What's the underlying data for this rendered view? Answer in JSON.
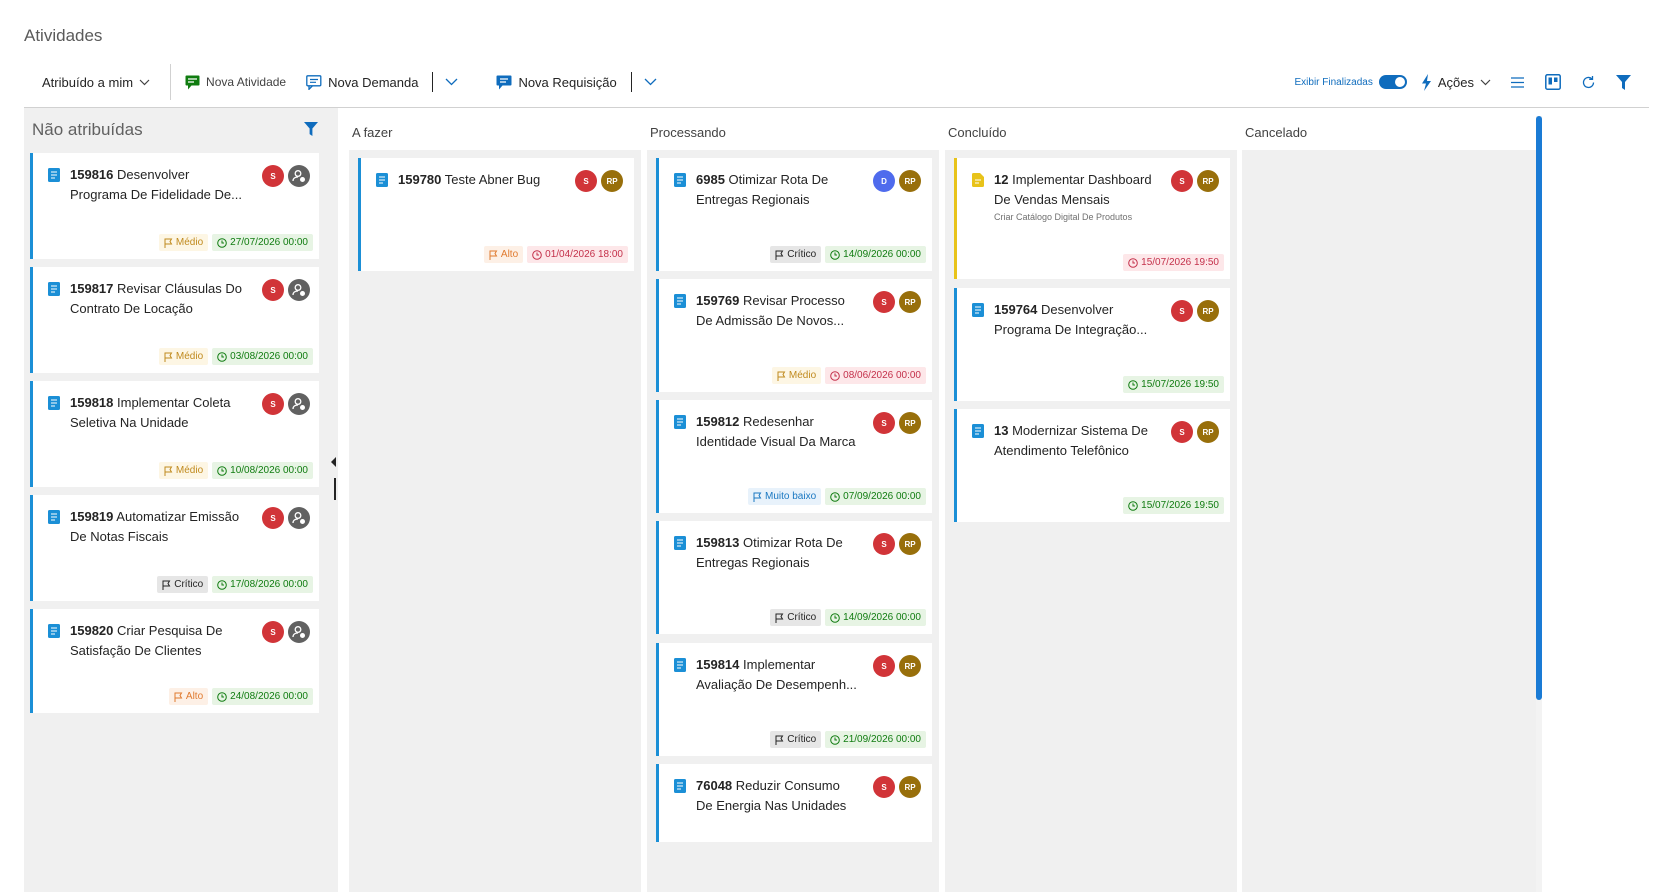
{
  "page": {
    "title": "Atividades"
  },
  "toolbar": {
    "assigned_filter": "Atribuído a mim",
    "new_activity": "Nova Atividade",
    "new_demand": "Nova Demanda",
    "new_request": "Nova Requisição",
    "show_finished": "Exibir Finalizadas",
    "actions": "Ações"
  },
  "colors": {
    "accent": "#0f6cbd",
    "card_border": "#1b8fd6",
    "card_border_yellow": "#e8c31a"
  },
  "unassigned": {
    "title": "Não atribuídas",
    "cards": [
      {
        "id": "159816",
        "title": "Desenvolver",
        "title2": "Programa De Fidelidade De...",
        "priority": "Médio",
        "date": "27/07/2026 00:00"
      },
      {
        "id": "159817",
        "title": "Revisar Cláusulas Do",
        "title2": "Contrato De Locação",
        "priority": "Médio",
        "date": "03/08/2026 00:00"
      },
      {
        "id": "159818",
        "title": "Implementar Coleta",
        "title2": "Seletiva Na Unidade",
        "priority": "Médio",
        "date": "10/08/2026 00:00"
      },
      {
        "id": "159819",
        "title": "Automatizar Emissão",
        "title2": "De Notas Fiscais",
        "priority": "Crítico",
        "date": "17/08/2026 00:00"
      },
      {
        "id": "159820",
        "title": "Criar Pesquisa De",
        "title2": "Satisfação De Clientes",
        "priority": "Alto",
        "date": "24/08/2026 00:00"
      }
    ]
  },
  "columns": [
    {
      "name": "A fazer",
      "cards": [
        {
          "id": "159780",
          "title": "Teste Abner Bug",
          "title2": "",
          "priority": "Alto",
          "date": "01/04/2026 18:00",
          "late": true,
          "av1": "S",
          "av2": "RP"
        }
      ]
    },
    {
      "name": "Processando",
      "cards": [
        {
          "id": "6985",
          "title": "Otimizar Rota De",
          "title2": "Entregas Regionais",
          "priority": "Crítico",
          "date": "14/09/2026 00:00",
          "late": false,
          "av1": "D",
          "av2": "RP"
        },
        {
          "id": "159769",
          "title": "Revisar Processo",
          "title2": "De Admissão De Novos...",
          "priority": "Médio",
          "date": "08/06/2026 00:00",
          "late": true,
          "av1": "S",
          "av2": "RP"
        },
        {
          "id": "159812",
          "title": "Redesenhar",
          "title2": "Identidade Visual Da Marca",
          "priority": "Muito baixo",
          "date": "07/09/2026 00:00",
          "late": false,
          "av1": "S",
          "av2": "RP"
        },
        {
          "id": "159813",
          "title": "Otimizar Rota De",
          "title2": "Entregas Regionais",
          "priority": "Crítico",
          "date": "14/09/2026 00:00",
          "late": false,
          "av1": "S",
          "av2": "RP"
        },
        {
          "id": "159814",
          "title": "Implementar",
          "title2": "Avaliação De Desempenh...",
          "priority": "Crítico",
          "date": "21/09/2026 00:00",
          "late": false,
          "av1": "S",
          "av2": "RP"
        },
        {
          "id": "76048",
          "title": "Reduzir Consumo",
          "title2": "De Energia Nas Unidades",
          "priority": "",
          "date": "",
          "late": false,
          "av1": "S",
          "av2": "RP"
        }
      ]
    },
    {
      "name": "Concluído",
      "cards": [
        {
          "id": "12",
          "title": "Implementar Dashboard",
          "title2": "De Vendas Mensais",
          "subtitle": "Criar Catálogo Digital De Produtos",
          "priority": "",
          "date": "15/07/2026 19:50",
          "late": true,
          "av1": "S",
          "av2": "RP"
        },
        {
          "id": "159764",
          "title": "Desenvolver",
          "title2": "Programa De Integração...",
          "priority": "",
          "date": "15/07/2026 19:50",
          "late": false,
          "av1": "S",
          "av2": "RP"
        },
        {
          "id": "13",
          "title": "Modernizar Sistema De",
          "title2": "Atendimento Telefônico",
          "priority": "",
          "date": "15/07/2026 19:50",
          "late": false,
          "av1": "S",
          "av2": "RP"
        }
      ]
    },
    {
      "name": "Cancelado",
      "cards": []
    }
  ]
}
